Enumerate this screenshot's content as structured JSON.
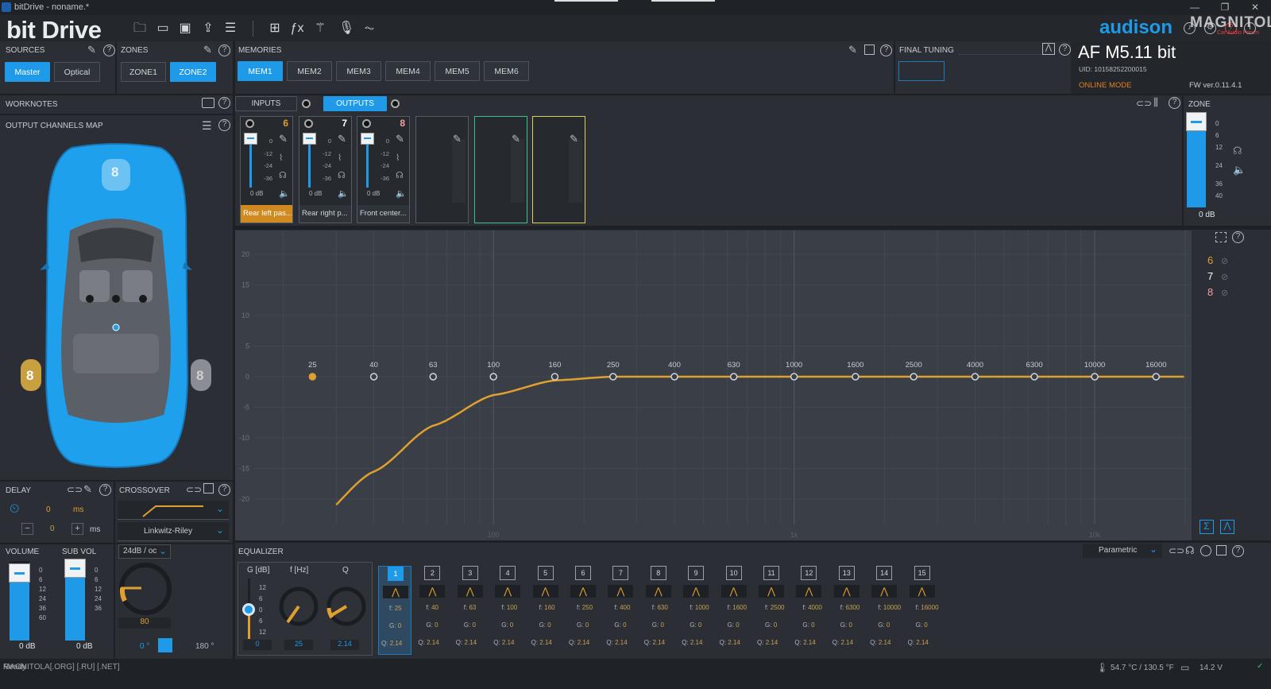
{
  "window": {
    "title": "bitDrive - noname.*"
  },
  "app": {
    "name": "bit Drive",
    "brand": "audison",
    "device": "AF M5.11 bit",
    "uid": "UID: 10158252200015",
    "mode": "ONLINE MODE",
    "fw": "FW ver.0.11.4.1",
    "watermark": "MAGNITOLA",
    "watermark_small": "Car Audio Forum"
  },
  "sources": {
    "header": "SOURCES",
    "items": [
      "Master",
      "Optical"
    ],
    "active": "Master"
  },
  "zones": {
    "header": "ZONES",
    "items": [
      "ZONE1",
      "ZONE2"
    ],
    "active": "ZONE2"
  },
  "memories": {
    "header": "MEMORIES",
    "items": [
      "MEM1",
      "MEM2",
      "MEM3",
      "MEM4",
      "MEM5",
      "MEM6"
    ],
    "active": "MEM1"
  },
  "final_tuning": {
    "header": "FINAL TUNING"
  },
  "worknotes": {
    "header": "WORKNOTES"
  },
  "map": {
    "header": "OUTPUT CHANNELS MAP",
    "speakers": [
      "8",
      "8",
      "8"
    ]
  },
  "io_tabs": {
    "inputs": "INPUTS",
    "outputs": "OUTPUTS",
    "active": "OUTPUTS"
  },
  "channels": [
    {
      "num": "6",
      "name": "Rear left pas...",
      "db": "0 dB",
      "color": "#e0a030",
      "active": true,
      "ticks": [
        "0",
        "-12",
        "-24",
        "-36"
      ]
    },
    {
      "num": "7",
      "name": "Rear right p...",
      "db": "0 dB",
      "color": "#ffffff",
      "active": false,
      "ticks": [
        "0",
        "-12",
        "-24",
        "-36"
      ]
    },
    {
      "num": "8",
      "name": "Front center...",
      "db": "0 dB",
      "color": "#f0a0a0",
      "active": false,
      "ticks": [
        "0",
        "-12",
        "-24",
        "-36"
      ]
    }
  ],
  "empty_cards": [
    {
      "border": "#555b64"
    },
    {
      "border": "#3cc090"
    },
    {
      "border": "#e0d050"
    }
  ],
  "zone_fader": {
    "header": "ZONE",
    "db": "0 dB",
    "ticks": [
      "0",
      "6",
      "12",
      "24",
      "36",
      "40"
    ]
  },
  "graph": {
    "y_ticks": [
      "20",
      "15",
      "10",
      "5",
      "0",
      "-5",
      "-10",
      "-15",
      "-20"
    ],
    "freqs": [
      "25",
      "40",
      "63",
      "100",
      "160",
      "250",
      "400",
      "630",
      "1000",
      "1600",
      "2500",
      "4000",
      "6300",
      "10000",
      "16000"
    ],
    "x_labels": [
      "100",
      "1k",
      "10k"
    ],
    "legend": [
      {
        "label": "6",
        "color": "#e0a030"
      },
      {
        "label": "7",
        "color": "#ffffff"
      },
      {
        "label": "8",
        "color": "#f0a0a0"
      }
    ]
  },
  "chart_data": {
    "type": "line",
    "x": [
      25,
      40,
      63,
      100,
      160,
      250,
      400,
      630,
      1000,
      1600,
      2500,
      4000,
      6300,
      10000,
      16000,
      20000
    ],
    "series": [
      {
        "values": [
          -24,
          -15.5,
          -8,
          -3,
          -0.6,
          0,
          0,
          0,
          0,
          0,
          0,
          0,
          0,
          0,
          0,
          0
        ]
      }
    ],
    "ylim": [
      -20,
      20
    ],
    "log_x": true,
    "grid": true
  },
  "delay": {
    "header": "DELAY",
    "value": "0",
    "unit": "ms",
    "step_value": "0",
    "step_unit": "ms",
    "minus": "−",
    "plus": "+"
  },
  "crossover": {
    "header": "CROSSOVER",
    "type": "Linkwitz-Riley",
    "slope": "24dB / oc",
    "freq": "80",
    "phase_0": "0 °",
    "phase_180": "180 °"
  },
  "volume": {
    "header": "VOLUME",
    "db": "0 dB",
    "ticks": [
      "0",
      "6",
      "12",
      "24",
      "36",
      "60"
    ]
  },
  "subvol": {
    "header": "SUB VOL",
    "db": "0 dB",
    "ticks": [
      "0",
      "6",
      "12",
      "24",
      "36"
    ]
  },
  "equalizer": {
    "header": "EQUALIZER",
    "mode": "Parametric",
    "gain_label": "G [dB]",
    "freq_label": "f [Hz]",
    "q_label": "Q",
    "gain_ticks": [
      "12",
      "6",
      "0",
      "6",
      "12"
    ],
    "gain": "0",
    "freq": "25",
    "q": "2.14",
    "bands": [
      {
        "n": "1",
        "f": "25",
        "g": "0",
        "q": "2.14"
      },
      {
        "n": "2",
        "f": "40",
        "g": "0",
        "q": "2.14"
      },
      {
        "n": "3",
        "f": "63",
        "g": "0",
        "q": "2.14"
      },
      {
        "n": "4",
        "f": "100",
        "g": "0",
        "q": "2.14"
      },
      {
        "n": "5",
        "f": "160",
        "g": "0",
        "q": "2.14"
      },
      {
        "n": "6",
        "f": "250",
        "g": "0",
        "q": "2.14"
      },
      {
        "n": "7",
        "f": "400",
        "g": "0",
        "q": "2.14"
      },
      {
        "n": "8",
        "f": "630",
        "g": "0",
        "q": "2.14"
      },
      {
        "n": "9",
        "f": "1000",
        "g": "0",
        "q": "2.14"
      },
      {
        "n": "10",
        "f": "1600",
        "g": "0",
        "q": "2.14"
      },
      {
        "n": "11",
        "f": "2500",
        "g": "0",
        "q": "2.14"
      },
      {
        "n": "12",
        "f": "4000",
        "g": "0",
        "q": "2.14"
      },
      {
        "n": "13",
        "f": "6300",
        "g": "0",
        "q": "2.14"
      },
      {
        "n": "14",
        "f": "10000",
        "g": "0",
        "q": "2.14"
      },
      {
        "n": "15",
        "f": "16000",
        "g": "0",
        "q": "2.14"
      }
    ],
    "f_key": "f:",
    "g_key": "G:",
    "q_key": "Q:"
  },
  "status": {
    "left": "Ready",
    "watermark": "MAGNITOLA[.ORG] [.RU] [.NET]",
    "temp": "54.7 °C / 130.5 °F",
    "voltage": "14.2 V"
  }
}
